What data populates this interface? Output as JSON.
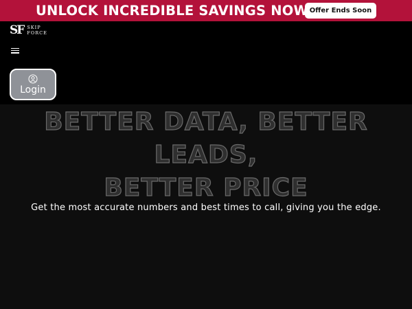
{
  "promo": {
    "headline": "UNLOCK INCREDIBLE SAVINGS NOW!",
    "offer_button": "Offer Ends Soon"
  },
  "brand": {
    "mark": "SF",
    "line1": "SKIP",
    "line2": "FORCE"
  },
  "header": {
    "menu_icon": "hamburger-menu-icon",
    "login_icon": "user-circle-icon",
    "login_label": "Login"
  },
  "hero": {
    "title_lines": [
      "BETTER DATA, BETTER",
      "LEADS,",
      "BETTER PRICE"
    ],
    "subtitle": "Get the most accurate numbers and best times to call, giving you the edge."
  },
  "colors": {
    "promo_bg": "#b3123a",
    "header_bg": "#000000",
    "hero_bg": "#0e0e0e",
    "login_bg": "#8f9298"
  }
}
